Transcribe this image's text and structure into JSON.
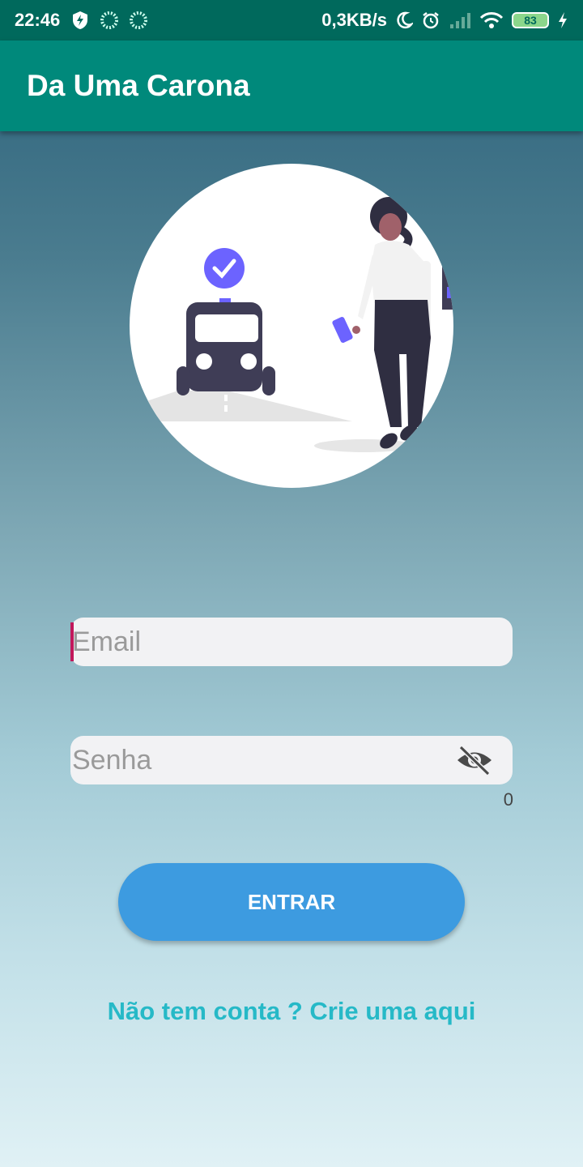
{
  "status_bar": {
    "time": "22:46",
    "network_speed": "0,3KB/s",
    "battery": "83",
    "icons": [
      "shield-bolt-icon",
      "spinner-icon",
      "spinner-icon",
      "moon-icon",
      "alarm-icon",
      "signal-icon",
      "wifi-icon",
      "battery-icon",
      "charging-icon"
    ]
  },
  "app_bar": {
    "title": "Da Uma Carona"
  },
  "login_form": {
    "email_placeholder": "Email",
    "password_placeholder": "Senha",
    "password_counter": "0",
    "submit_label": "ENTRAR",
    "signup_link": "Não tem conta ? Crie uma aqui"
  },
  "colors": {
    "status_bar": "#00695c",
    "app_bar": "#00897b",
    "button": "#3d9be0",
    "link": "#26b9c7",
    "caret": "#c2185b"
  }
}
